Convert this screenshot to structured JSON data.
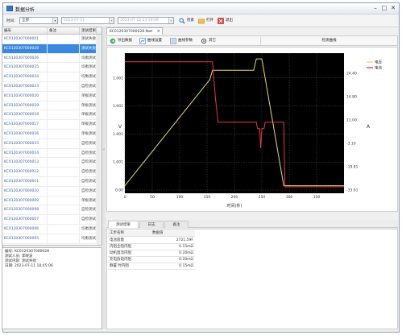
{
  "window": {
    "title": "数据分析"
  },
  "toolbar": {
    "time_label": "时间：",
    "time_value": "全部",
    "date_from": "2023-07-11",
    "date_to": "2023-07-12 23:59:59",
    "search_label": "检索",
    "open_label": "打开",
    "exit_label": "退出"
  },
  "list": {
    "headers": [
      "编号",
      "备注",
      "测试结果"
    ],
    "rows": [
      {
        "id": "KC0120307000001",
        "note": "",
        "result": "测试失败"
      },
      {
        "id": "KC0120307000028",
        "note": "",
        "result": "测试失败"
      },
      {
        "id": "KC0120307000026",
        "note": "",
        "result": "均衡测试"
      },
      {
        "id": "KC0120307000025",
        "note": "",
        "result": "均衡测试"
      },
      {
        "id": "KC0120307000024",
        "note": "",
        "result": "均衡测试"
      },
      {
        "id": "KC0120307000023",
        "note": "",
        "result": "自检测试"
      },
      {
        "id": "KC0120307000020",
        "note": "",
        "result": "单板测试"
      },
      {
        "id": "KC0120307000019",
        "note": "",
        "result": "单板测试"
      },
      {
        "id": "KC0120307000018",
        "note": "",
        "result": "单板测试"
      },
      {
        "id": "KC0120307000017",
        "note": "",
        "result": "单板测试"
      },
      {
        "id": "KC0120307000016",
        "note": "",
        "result": "单板测试"
      },
      {
        "id": "KC0120307000015",
        "note": "",
        "result": "自检测试"
      },
      {
        "id": "KC0120307000014",
        "note": "",
        "result": "自检测试"
      },
      {
        "id": "KC0120307000013",
        "note": "",
        "result": "自检测试"
      },
      {
        "id": "KC0120307000012",
        "note": "",
        "result": "自检测试"
      },
      {
        "id": "KC0120307000011",
        "note": "",
        "result": "自检测试"
      },
      {
        "id": "KC0120307000010",
        "note": "",
        "result": "自检测试"
      },
      {
        "id": "KC0120307000009",
        "note": "",
        "result": "单板测试"
      },
      {
        "id": "KC0120307000008",
        "note": "",
        "result": "自检测试"
      },
      {
        "id": "KC0120307000007",
        "note": "",
        "result": "自检测试"
      },
      {
        "id": "KC0120307000006",
        "note": "",
        "result": "均衡测试"
      },
      {
        "id": "KC0120307000005",
        "note": "",
        "result": "均衡测试"
      }
    ]
  },
  "info": {
    "lines": [
      "编号: KC0120307000028",
      "测试人员: 李晓波",
      "测试内容: 测试失败",
      "日期: 2023-07-11 18:45:06"
    ]
  },
  "doc_tab": {
    "label": "KC0120307000028.Nwt"
  },
  "chart_tools": {
    "export_label": "导出数据",
    "scale_label": "曲线设置",
    "curve_label": "曲线参数",
    "other_label": "其它",
    "title_label": "检测曲线"
  },
  "chart_data": {
    "type": "line",
    "xlabel": "时间(秒)",
    "ylabel_left": "V",
    "ylabel_right": "A",
    "xlim": [
      0,
      400
    ],
    "xticks": [
      0,
      50,
      100,
      150,
      200,
      250,
      300,
      350
    ],
    "ylim_left": [
      0,
      3.7
    ],
    "yticks_left": [
      "0.00",
      "1.001",
      "1.001",
      "1.001",
      "1.001"
    ],
    "ylim_right": [
      -35,
      30
    ],
    "yticks_right": [
      "-33.91",
      "-19.81",
      "-3.10",
      "11.00",
      "14.80",
      "24.40"
    ],
    "legend_position": "top-right",
    "series": [
      {
        "name": "电压",
        "color": "#e6e06a",
        "axis": "left",
        "x": [
          0,
          155,
          160,
          235,
          240,
          250,
          290,
          400
        ],
        "y": [
          0.2,
          3.0,
          3.25,
          3.25,
          3.55,
          3.55,
          0.2,
          0.2
        ]
      },
      {
        "name": "电流",
        "color": "#e83a3a",
        "axis": "right",
        "x": [
          0,
          150,
          160,
          165,
          170,
          240,
          242,
          246,
          248,
          250,
          254,
          256,
          270,
          290,
          292,
          400
        ],
        "y": [
          26,
          26,
          26,
          10,
          -2,
          -2,
          -5,
          -5,
          -14,
          -5,
          -5,
          -2,
          -2,
          -2,
          -32,
          -32
        ]
      }
    ]
  },
  "bottom_tabs": [
    "测试结果",
    "日志",
    "备注"
  ],
  "params": {
    "headers": [
      "工步名称",
      "数据值"
    ],
    "rows": [
      {
        "k": "电池容量",
        "v": "2721.59F"
      },
      {
        "k": "内阻全阻内阻",
        "v": "0.15mΩ"
      },
      {
        "k": "动机直流内阻",
        "v": "0.20mΩ"
      },
      {
        "k": "充电放电内阻",
        "v": "0.20mΩ"
      },
      {
        "k": "静置 时内阻",
        "v": "0.15mΩ"
      }
    ]
  }
}
